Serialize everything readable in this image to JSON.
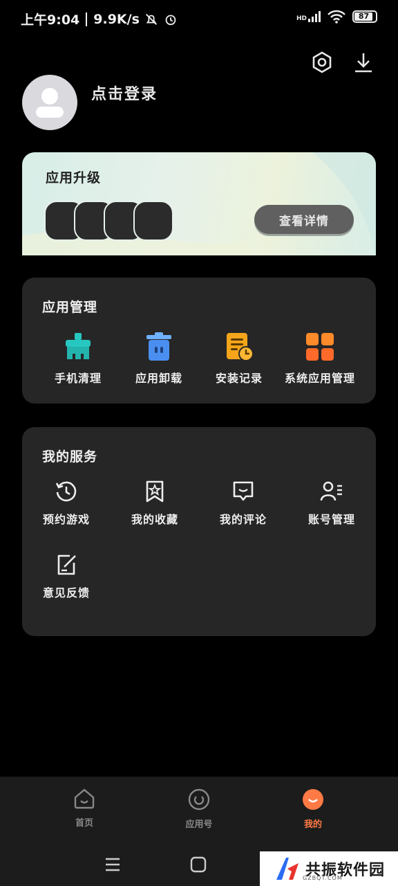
{
  "status_bar": {
    "time": "上午9:04",
    "speed": "9.9K/s",
    "battery": "87",
    "network": "HD"
  },
  "header": {
    "settings_icon": "settings-hex-icon",
    "download_icon": "download-icon"
  },
  "profile": {
    "login_label": "点击登录"
  },
  "upgrade": {
    "title": "应用升级",
    "details_button": "查看详情"
  },
  "app_management": {
    "title": "应用管理",
    "items": [
      {
        "label": "手机清理",
        "icon": "broom-clean-icon",
        "color": "#27c7c1"
      },
      {
        "label": "应用卸载",
        "icon": "trash-icon",
        "color": "#4a8ff0"
      },
      {
        "label": "安装记录",
        "icon": "install-record-icon",
        "color": "#f4a51a"
      },
      {
        "label": "系统应用管理",
        "icon": "grid-apps-icon",
        "color": "#ff6a2a"
      }
    ]
  },
  "my_services": {
    "title": "我的服务",
    "items": [
      {
        "label": "预约游戏",
        "icon": "history-clock-icon"
      },
      {
        "label": "我的收藏",
        "icon": "bookmark-star-icon"
      },
      {
        "label": "我的评论",
        "icon": "comment-icon"
      },
      {
        "label": "账号管理",
        "icon": "account-list-icon"
      },
      {
        "label": "意见反馈",
        "icon": "feedback-edit-icon"
      }
    ]
  },
  "bottom_nav": {
    "items": [
      {
        "label": "首页",
        "icon": "home-icon"
      },
      {
        "label": "应用号",
        "icon": "app-number-icon"
      },
      {
        "label": "我的",
        "icon": "me-icon",
        "active": true
      }
    ],
    "accent": "#ff7a45"
  },
  "watermark_brand": {
    "name": "共振软件园",
    "sub": "GZBQT.COM"
  }
}
